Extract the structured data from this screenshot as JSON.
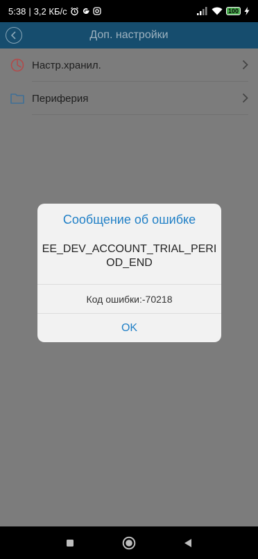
{
  "status_bar": {
    "time": "5:38",
    "separator": "|",
    "speed": "3,2 КБ/с",
    "battery": "100"
  },
  "header": {
    "title": "Доп. настройки",
    "back_icon": "chevron-left-icon"
  },
  "list": {
    "items": [
      {
        "label": "Настр.хранил.",
        "icon": "clock-pie-icon"
      },
      {
        "label": "Периферия",
        "icon": "folder-icon"
      }
    ]
  },
  "dialog": {
    "title": "Сообщение об ошибке",
    "message_line1": "EE_DEV_ACCOUNT_TRIAL_PERI",
    "message_line2": "OD_END",
    "code_text": "Код ошибки:-70218",
    "ok_label": "OK"
  },
  "colors": {
    "accent": "#1f7fc6",
    "header_bg": "#164d6e",
    "overlay_bg": "#7c7c7c",
    "icon_red": "#b24a4a",
    "icon_blue": "#3f6f96"
  }
}
